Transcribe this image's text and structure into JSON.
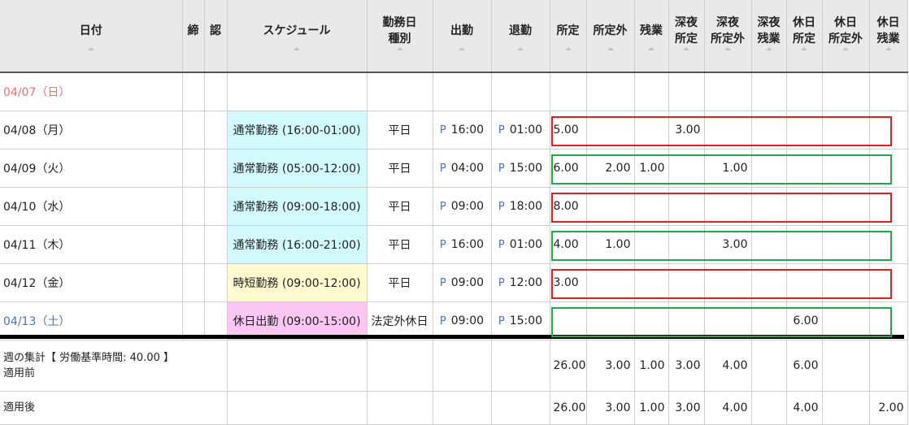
{
  "headers": [
    {
      "key": "date",
      "label": "日付"
    },
    {
      "key": "close",
      "label": "締"
    },
    {
      "key": "approve",
      "label": "認"
    },
    {
      "key": "schedule",
      "label": "スケジュール"
    },
    {
      "key": "daytype",
      "label": "勤務日\n種別"
    },
    {
      "key": "in",
      "label": "出勤"
    },
    {
      "key": "out",
      "label": "退勤"
    },
    {
      "key": "shotei",
      "label": "所定"
    },
    {
      "key": "shoteigai",
      "label": "所定外"
    },
    {
      "key": "zangyo",
      "label": "残業"
    },
    {
      "key": "shinya_shotei",
      "label": "深夜\n所定"
    },
    {
      "key": "shinya_shoteigai",
      "label": "深夜\n所定外"
    },
    {
      "key": "shinya_zangyo",
      "label": "深夜\n残業"
    },
    {
      "key": "kyujitsu_shotei",
      "label": "休日\n所定"
    },
    {
      "key": "kyujitsu_shoteigai",
      "label": "休日\n所定外"
    },
    {
      "key": "kyujitsu_zangyo",
      "label": "休日\n残業"
    }
  ],
  "time_marker": "P",
  "rows": [
    {
      "date": "04/07（日）",
      "day": "sun",
      "schedule": "",
      "sched_color": "",
      "daytype": "",
      "in": "",
      "out": "",
      "v": [
        "",
        "",
        "",
        "",
        "",
        "",
        "",
        "",
        ""
      ],
      "box": ""
    },
    {
      "date": "04/08（月）",
      "day": "weekday",
      "schedule": "通常勤務 (16:00-01:00)",
      "sched_color": "cyan",
      "daytype": "平日",
      "in": "16:00",
      "out": "01:00",
      "v": [
        "5.00",
        "",
        "",
        "3.00",
        "",
        "",
        "",
        "",
        ""
      ],
      "box": "red"
    },
    {
      "date": "04/09（火）",
      "day": "weekday",
      "schedule": "通常勤務 (05:00-12:00)",
      "sched_color": "cyan",
      "daytype": "平日",
      "in": "04:00",
      "out": "15:00",
      "v": [
        "6.00",
        "2.00",
        "1.00",
        "",
        "1.00",
        "",
        "",
        "",
        ""
      ],
      "box": "green"
    },
    {
      "date": "04/10（水）",
      "day": "weekday",
      "schedule": "通常勤務 (09:00-18:00)",
      "sched_color": "cyan",
      "daytype": "平日",
      "in": "09:00",
      "out": "18:00",
      "v": [
        "8.00",
        "",
        "",
        "",
        "",
        "",
        "",
        "",
        ""
      ],
      "box": "red"
    },
    {
      "date": "04/11（木）",
      "day": "weekday",
      "schedule": "通常勤務 (16:00-21:00)",
      "sched_color": "cyan",
      "daytype": "平日",
      "in": "16:00",
      "out": "01:00",
      "v": [
        "4.00",
        "1.00",
        "",
        "",
        "3.00",
        "",
        "",
        "",
        ""
      ],
      "box": "green"
    },
    {
      "date": "04/12（金）",
      "day": "weekday",
      "schedule": "時短勤務 (09:00-12:00)",
      "sched_color": "yellow",
      "daytype": "平日",
      "in": "09:00",
      "out": "12:00",
      "v": [
        "3.00",
        "",
        "",
        "",
        "",
        "",
        "",
        "",
        ""
      ],
      "box": "red"
    },
    {
      "date": "04/13（土）",
      "day": "sat",
      "schedule": "休日出勤 (09:00-15:00)",
      "sched_color": "pink",
      "daytype": "法定外休日",
      "in": "09:00",
      "out": "15:00",
      "v": [
        "",
        "",
        "",
        "",
        "",
        "",
        "6.00",
        "",
        ""
      ],
      "box": "green"
    }
  ],
  "summary": {
    "label_line1": "週の集計【 労働基準時間: 40.00 】",
    "label_line2": "適用前",
    "before": [
      "26.00",
      "3.00",
      "1.00",
      "3.00",
      "4.00",
      "",
      "6.00",
      "",
      ""
    ],
    "after_label": "適用後",
    "after": [
      "26.00",
      "3.00",
      "1.00",
      "3.00",
      "4.00",
      "",
      "4.00",
      "",
      "2.00"
    ]
  },
  "colors": {
    "box_red": "#e02020",
    "box_green": "#22a84a",
    "sunday": "#e57373",
    "saturday": "#4a73b8"
  }
}
